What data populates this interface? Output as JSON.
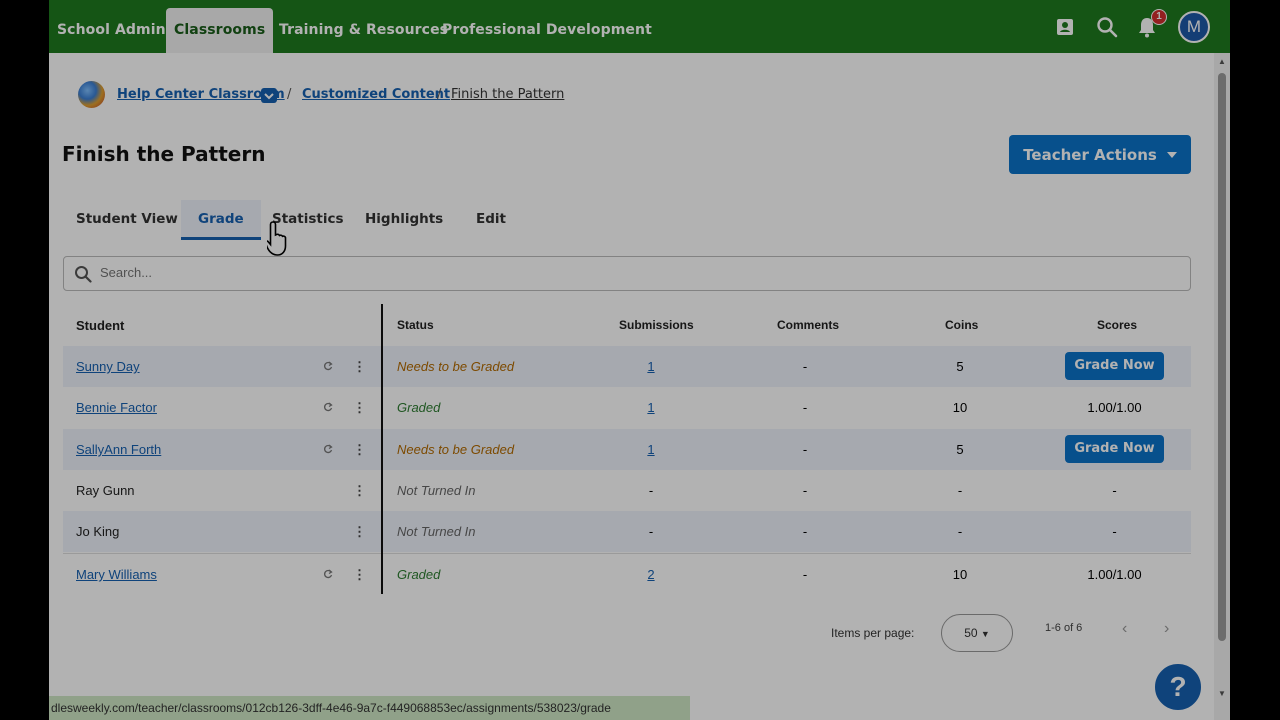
{
  "nav": {
    "items": [
      "School Admin",
      "Classrooms",
      "Training & Resources",
      "Professional Development"
    ],
    "notification_count": "1",
    "avatar_initial": "M"
  },
  "breadcrumb": {
    "classroom": "Help Center Classroom",
    "section": "Customized Content",
    "current": "Finish the Pattern",
    "sep": "/"
  },
  "page": {
    "title": "Finish the Pattern",
    "teacher_actions": "Teacher Actions"
  },
  "tabs": [
    "Student View",
    "Grade",
    "Statistics",
    "Highlights",
    "Edit"
  ],
  "search": {
    "placeholder": "Search..."
  },
  "table": {
    "headers": [
      "Student",
      "Status",
      "Submissions",
      "Comments",
      "Coins",
      "Scores"
    ],
    "rows": [
      {
        "student": "Sunny Day",
        "status": "Needs to be Graded",
        "submissions": "1",
        "comments": "-",
        "coins": "5",
        "score": "Grade Now"
      },
      {
        "student": "Bennie Factor",
        "status": "Graded",
        "submissions": "1",
        "comments": "-",
        "coins": "10",
        "score": "1.00/1.00"
      },
      {
        "student": "SallyAnn Forth",
        "status": "Needs to be Graded",
        "submissions": "1",
        "comments": "-",
        "coins": "5",
        "score": "Grade Now"
      },
      {
        "student": "Ray Gunn",
        "status": "Not Turned In",
        "submissions": "-",
        "comments": "-",
        "coins": "-",
        "score": "-"
      },
      {
        "student": "Jo King",
        "status": "Not Turned In",
        "submissions": "-",
        "comments": "-",
        "coins": "-",
        "score": "-"
      },
      {
        "student": "Mary Williams",
        "status": "Graded",
        "submissions": "2",
        "comments": "-",
        "coins": "10",
        "score": "1.00/1.00"
      }
    ]
  },
  "pagination": {
    "label": "Items per page:",
    "per_page": "50",
    "range": "1-6 of 6"
  },
  "status_url": "dlesweekly.com/teacher/classrooms/012cb126-3dff-4e46-9a7c-f449068853ec/assignments/538023/grade",
  "colors": {
    "nav": "#1f7a1f",
    "primary": "#0b73c9",
    "needs": "#b36b00",
    "graded": "#2e7d32"
  }
}
